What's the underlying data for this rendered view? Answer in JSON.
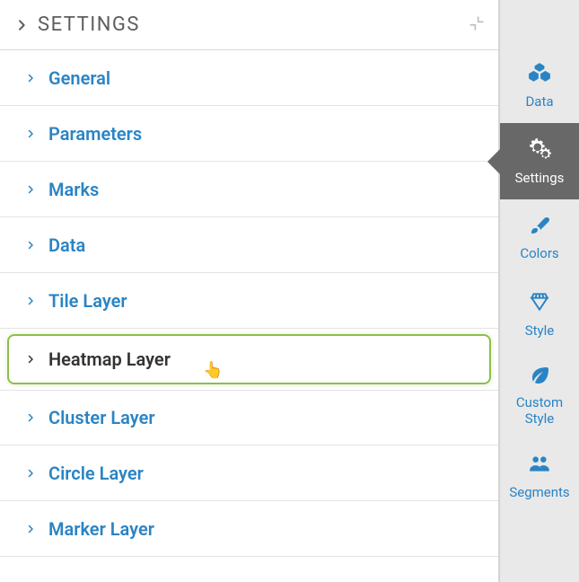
{
  "header": {
    "title": "SETTINGS"
  },
  "sections": {
    "general": "General",
    "parameters": "Parameters",
    "marks": "Marks",
    "data": "Data",
    "tile_layer": "Tile Layer",
    "heatmap_layer": "Heatmap Layer",
    "cluster_layer": "Cluster Layer",
    "circle_layer": "Circle Layer",
    "marker_layer": "Marker Layer"
  },
  "sidebar": {
    "data": "Data",
    "settings": "Settings",
    "colors": "Colors",
    "style": "Style",
    "custom_style": "Custom Style",
    "segments": "Segments"
  },
  "colors": {
    "accent": "#2a84c4",
    "highlight_border": "#8bbf47",
    "sidebar_active": "#686868"
  }
}
